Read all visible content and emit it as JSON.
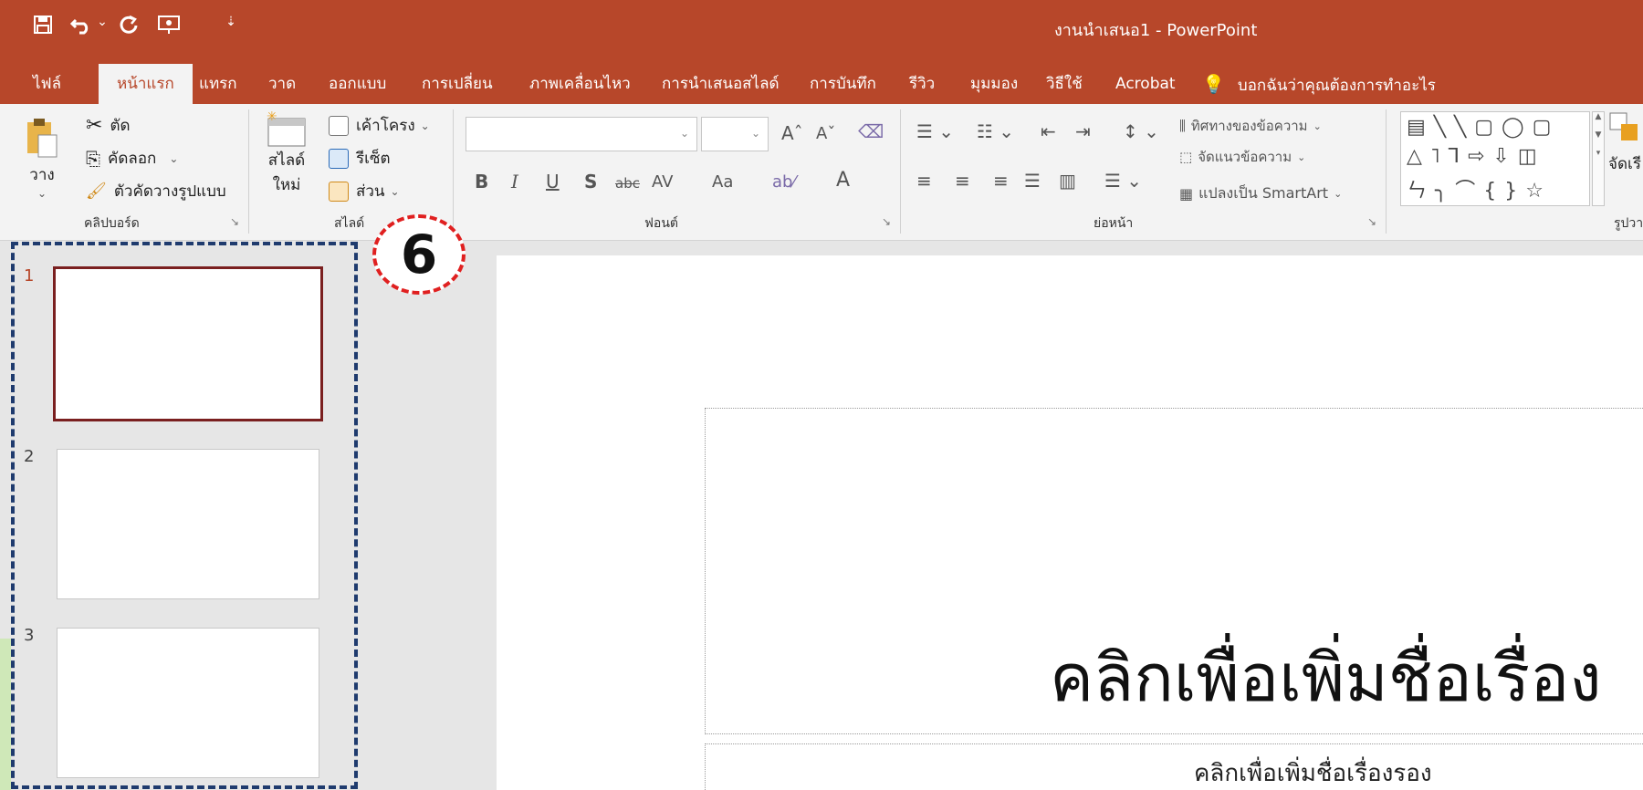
{
  "window": {
    "title": "งานนำเสนอ1  -  PowerPoint",
    "accent_color": "#b7472a"
  },
  "quick_access": [
    {
      "name": "save-icon",
      "glyph": "🖫"
    },
    {
      "name": "undo-icon",
      "glyph": "↶"
    },
    {
      "name": "undo-dropdown-icon",
      "glyph": "⌄"
    },
    {
      "name": "redo-icon",
      "glyph": "↻"
    },
    {
      "name": "slideshow-icon",
      "glyph": "▣"
    },
    {
      "name": "customize-qat-icon",
      "glyph": "⇣"
    }
  ],
  "tabs": [
    "ไฟล์",
    "หน้าแรก",
    "แทรก",
    "วาด",
    "ออกแบบ",
    "การเปลี่ยน",
    "ภาพเคลื่อนไหว",
    "การนำเสนอสไลด์",
    "การบันทึก",
    "รีวิว",
    "มุมมอง",
    "วิธีใช้",
    "Acrobat"
  ],
  "active_tab": "หน้าแรก",
  "tell_me": "บอกฉันว่าคุณต้องการทำอะไร",
  "ribbon": {
    "clipboard": {
      "paste": "วาง",
      "cut": "ตัด",
      "copy": "คัดลอก",
      "format_painter": "ตัวคัดวางรูปแบบ",
      "label": "คลิปบอร์ด"
    },
    "slides": {
      "new_slide_line1": "สไลด์",
      "new_slide_line2": "ใหม่",
      "layout": "เค้าโครง",
      "reset": "รีเซ็ต",
      "section": "ส่วน",
      "label": "สไลด์"
    },
    "font": {
      "label": "ฟอนต์",
      "bold": "B",
      "italic": "I",
      "underline": "U",
      "shadow": "S",
      "strike": "abc",
      "spacing": "AV",
      "change_case": "Aa",
      "grow": "Aˆ",
      "shrink": "Aˇ",
      "color": "A"
    },
    "paragraph": {
      "text_direction": "ทิศทางของข้อความ",
      "align_text": "จัดแนวข้อความ",
      "smartart": "แปลงเป็น SmartArt",
      "label": "ย่อหน้า"
    },
    "drawing": {
      "shapes_row1": "▤ ╲ ╲ ▢ ◯ ▢",
      "shapes_row2": "△ ˥ ⅂ ⇨ ⇩ ◫",
      "shapes_row3": "ㄣ ╮ ⌒ { } ☆",
      "arrange": "จัดเรี",
      "label": "รูปวา"
    }
  },
  "slides": [
    {
      "number": "1",
      "selected": true
    },
    {
      "number": "2",
      "selected": false
    },
    {
      "number": "3",
      "selected": false
    }
  ],
  "annotation": {
    "marker": "6",
    "marker_color": "#e02020",
    "box_color": "#1f3b6e"
  },
  "slide": {
    "title_placeholder": "คลิกเพื่อเพิ่มชื่อเรื่อง",
    "subtitle_placeholder": "คลิกเพื่อเพิ่มชื่อเรื่องรอง"
  }
}
